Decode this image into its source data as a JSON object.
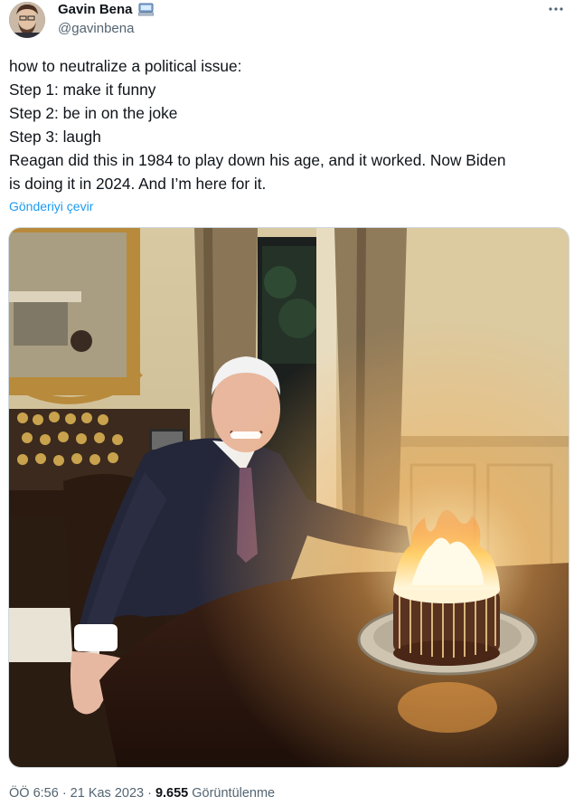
{
  "author": {
    "display_name": "Gavin Bena",
    "handle": "@gavinbena",
    "badge_icon": "computer-emoji-icon",
    "avatar_icon": "profile-photo"
  },
  "tweet": {
    "lines": [
      "how to neutralize a political issue:",
      "Step 1: make it funny",
      "Step 2: be in on the joke",
      "Step 3: laugh",
      "Reagan did this in 1984 to play down his age, and it worked. Now Biden",
      "is doing it in 2024. And I’m here for it."
    ],
    "translate_label": "Gönderiyi çevir"
  },
  "media": {
    "description_icon": "photo-man-with-flaming-birthday-cake"
  },
  "meta": {
    "time": "ÖÖ 6:56",
    "separator1": "·",
    "date": "21 Kas 2023",
    "separator2": "·",
    "views_count": "9.655",
    "views_label": "Görüntülenme"
  },
  "colors": {
    "link": "#1d9bf0",
    "secondary_text": "#536471",
    "primary_text": "#0f1419"
  }
}
